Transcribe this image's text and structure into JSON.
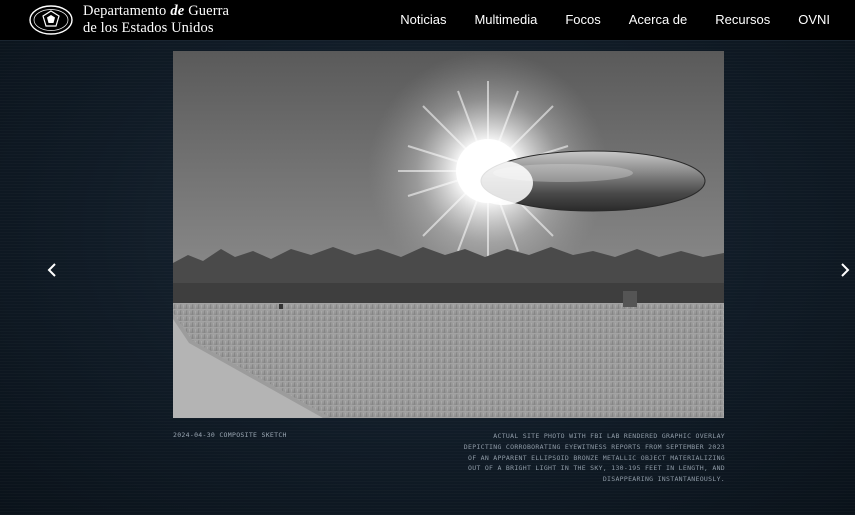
{
  "header": {
    "brand_line1_a": "Departamento",
    "brand_line1_de": "de",
    "brand_line1_b": "Guerra",
    "brand_line2": "de los Estados Unidos",
    "seal_icon": "department-seal-icon"
  },
  "nav": {
    "items": [
      {
        "label": "Noticias"
      },
      {
        "label": "Multimedia"
      },
      {
        "label": "Focos"
      },
      {
        "label": "Acerca de"
      },
      {
        "label": "Recursos"
      },
      {
        "label": "OVNI"
      }
    ]
  },
  "carousel": {
    "prev_icon": "chevron-left-icon",
    "next_icon": "chevron-right-icon",
    "caption_left": "2024-04-30 COMPOSITE SKETCH",
    "caption_right": "ACTUAL SITE PHOTO WITH FBI LAB RENDERED GRAPHIC OVERLAY DEPICTING CORROBORATING EYEWITNESS REPORTS FROM SEPTEMBER 2023 OF AN APPARENT ELLIPSOID BRONZE METALLIC OBJECT MATERIALIZING OUT OF A BRIGHT LIGHT IN THE SKY, 130-195 FEET IN LENGTH, AND DISAPPEARING INSTANTANEOUSLY."
  },
  "colors": {
    "header_bg": "#000000",
    "page_bg": "#101b26",
    "caption_text": "#8e9aa6"
  }
}
